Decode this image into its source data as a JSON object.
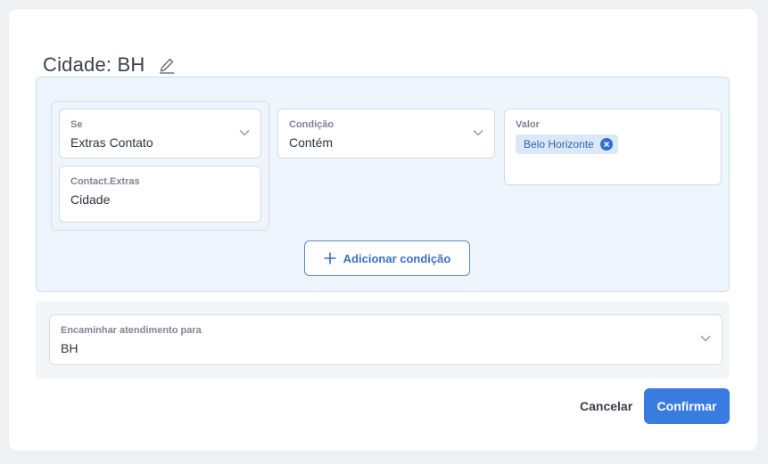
{
  "dialog": {
    "title": "Cidade: BH"
  },
  "condition": {
    "se": {
      "label": "Se",
      "value": "Extras Contato"
    },
    "extras": {
      "label": "Contact.Extras",
      "value": "Cidade"
    },
    "condicao": {
      "label": "Condição",
      "value": "Contém"
    },
    "valor": {
      "label": "Valor",
      "chips": [
        "Belo Horizonte"
      ]
    },
    "add_condition_label": "Adicionar condição"
  },
  "route": {
    "label": "Encaminhar atendimento para",
    "value": "BH"
  },
  "actions": {
    "cancel_label": "Cancelar",
    "confirm_label": "Confirmar"
  },
  "colors": {
    "primary": "#3a7be0",
    "chip_bg": "#dbe8f8",
    "condition_bg": "#eef5fc"
  }
}
